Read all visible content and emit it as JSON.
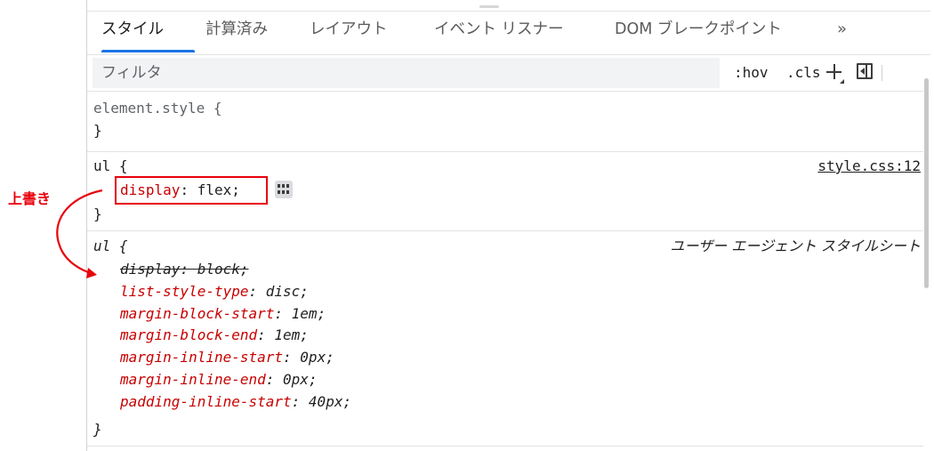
{
  "tabs": {
    "items": [
      {
        "label": "スタイル"
      },
      {
        "label": "計算済み"
      },
      {
        "label": "レイアウト"
      },
      {
        "label": "イベント リスナー"
      },
      {
        "label": "DOM ブレークポイント"
      }
    ],
    "more_label": "»"
  },
  "filter": {
    "placeholder": "フィルタ",
    "hov_label": ":hov",
    "cls_label": ".cls"
  },
  "rules": {
    "element_style": {
      "selector": "element.style",
      "open": "{",
      "close": "}"
    },
    "author_ul": {
      "selector": "ul",
      "open": "{",
      "close": "}",
      "source": "style.css:12",
      "prop_name": "display",
      "colon": ":",
      "prop_value": "flex",
      "semicolon": ";"
    },
    "ua_ul": {
      "selector": "ul",
      "open": "{",
      "close": "}",
      "source": "ユーザー エージェント スタイルシート",
      "declarations": [
        {
          "name": "display",
          "value": "block",
          "overridden": true
        },
        {
          "name": "list-style-type",
          "value": "disc",
          "overridden": false
        },
        {
          "name": "margin-block-start",
          "value": "1em",
          "overridden": false
        },
        {
          "name": "margin-block-end",
          "value": "1em",
          "overridden": false
        },
        {
          "name": "margin-inline-start",
          "value": "0px",
          "overridden": false
        },
        {
          "name": "margin-inline-end",
          "value": "0px",
          "overridden": false
        },
        {
          "name": "padding-inline-start",
          "value": "40px",
          "overridden": false
        }
      ]
    }
  },
  "annotation": {
    "label": "上書き",
    "color": "#e8000b"
  },
  "colors": {
    "accent": "#1a73e8",
    "property_name": "#c80000",
    "filter_bg": "#f1f3f4"
  },
  "icons": {
    "flex_badge": "flexbox-editor-icon",
    "sidebar": "toggle-sidebar-icon",
    "plus": "new-style-rule-icon"
  }
}
